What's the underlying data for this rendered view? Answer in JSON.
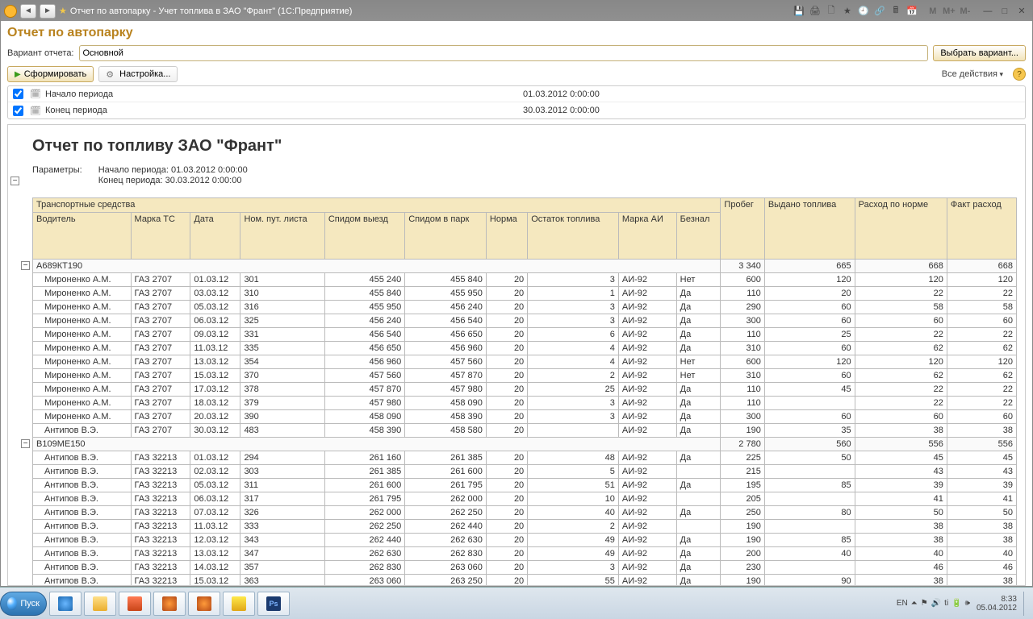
{
  "titlebar": {
    "title": "Отчет по автопарку - Учет топлива в ЗАО \"Франт\"  (1С:Предприятие)",
    "mem_buttons": [
      "M",
      "M+",
      "M-"
    ]
  },
  "form": {
    "title": "Отчет по автопарку",
    "variant_label": "Вариант отчета:",
    "variant_value": "Основной",
    "choose_variant_btn": "Выбрать вариант...",
    "run_btn": "Сформировать",
    "settings_btn": "Настройка...",
    "all_actions": "Все действия"
  },
  "period": {
    "start_label": "Начало периода",
    "start_value": "01.03.2012 0:00:00",
    "end_label": "Конец периода",
    "end_value": "30.03.2012 0:00:00"
  },
  "report": {
    "title": "Отчет по топливу ЗАО \"Франт\"",
    "params_label": "Параметры:",
    "params_lines": [
      "Начало периода: 01.03.2012 0:00:00",
      "Конец периода: 30.03.2012 0:00:00"
    ],
    "group_header": "Транспортные средства",
    "columns_top": {
      "mileage": "Пробег",
      "fuel_issued": "Выдано топлива",
      "norm_consumption": "Расход по норме",
      "actual_consumption": "Факт расход"
    },
    "columns": [
      "Водитель",
      "Марка ТС",
      "Дата",
      "Ном. пут. листа",
      "Спидом выезд",
      "Спидом в парк",
      "Норма",
      "Остаток топлива",
      "Марка АИ",
      "Безнал"
    ],
    "groups": [
      {
        "name": "А689КТ190",
        "totals": {
          "mileage": "3 340",
          "issued": "665",
          "norm": "668",
          "actual": "668"
        },
        "rows": [
          {
            "driver": "Мироненко А.М.",
            "make": "ГАЗ 2707",
            "date": "01.03.12",
            "waybill": "301",
            "odo_out": "455 240",
            "odo_in": "455 840",
            "norm": "20",
            "rest": "3",
            "fuel": "АИ-92",
            "cashless": "Нет",
            "mileage": "600",
            "issued": "120",
            "normc": "120",
            "actual": "120"
          },
          {
            "driver": "Мироненко А.М.",
            "make": "ГАЗ 2707",
            "date": "03.03.12",
            "waybill": "310",
            "odo_out": "455 840",
            "odo_in": "455 950",
            "norm": "20",
            "rest": "1",
            "fuel": "АИ-92",
            "cashless": "Да",
            "mileage": "110",
            "issued": "20",
            "normc": "22",
            "actual": "22"
          },
          {
            "driver": "Мироненко А.М.",
            "make": "ГАЗ 2707",
            "date": "05.03.12",
            "waybill": "316",
            "odo_out": "455 950",
            "odo_in": "456 240",
            "norm": "20",
            "rest": "3",
            "fuel": "АИ-92",
            "cashless": "Да",
            "mileage": "290",
            "issued": "60",
            "normc": "58",
            "actual": "58"
          },
          {
            "driver": "Мироненко А.М.",
            "make": "ГАЗ 2707",
            "date": "06.03.12",
            "waybill": "325",
            "odo_out": "456 240",
            "odo_in": "456 540",
            "norm": "20",
            "rest": "3",
            "fuel": "АИ-92",
            "cashless": "Да",
            "mileage": "300",
            "issued": "60",
            "normc": "60",
            "actual": "60"
          },
          {
            "driver": "Мироненко А.М.",
            "make": "ГАЗ 2707",
            "date": "09.03.12",
            "waybill": "331",
            "odo_out": "456 540",
            "odo_in": "456 650",
            "norm": "20",
            "rest": "6",
            "fuel": "АИ-92",
            "cashless": "Да",
            "mileage": "110",
            "issued": "25",
            "normc": "22",
            "actual": "22"
          },
          {
            "driver": "Мироненко А.М.",
            "make": "ГАЗ 2707",
            "date": "11.03.12",
            "waybill": "335",
            "odo_out": "456 650",
            "odo_in": "456 960",
            "norm": "20",
            "rest": "4",
            "fuel": "АИ-92",
            "cashless": "Да",
            "mileage": "310",
            "issued": "60",
            "normc": "62",
            "actual": "62"
          },
          {
            "driver": "Мироненко А.М.",
            "make": "ГАЗ 2707",
            "date": "13.03.12",
            "waybill": "354",
            "odo_out": "456 960",
            "odo_in": "457 560",
            "norm": "20",
            "rest": "4",
            "fuel": "АИ-92",
            "cashless": "Нет",
            "mileage": "600",
            "issued": "120",
            "normc": "120",
            "actual": "120"
          },
          {
            "driver": "Мироненко А.М.",
            "make": "ГАЗ 2707",
            "date": "15.03.12",
            "waybill": "370",
            "odo_out": "457 560",
            "odo_in": "457 870",
            "norm": "20",
            "rest": "2",
            "fuel": "АИ-92",
            "cashless": "Нет",
            "mileage": "310",
            "issued": "60",
            "normc": "62",
            "actual": "62"
          },
          {
            "driver": "Мироненко А.М.",
            "make": "ГАЗ 2707",
            "date": "17.03.12",
            "waybill": "378",
            "odo_out": "457 870",
            "odo_in": "457 980",
            "norm": "20",
            "rest": "25",
            "fuel": "АИ-92",
            "cashless": "Да",
            "mileage": "110",
            "issued": "45",
            "normc": "22",
            "actual": "22"
          },
          {
            "driver": "Мироненко А.М.",
            "make": "ГАЗ 2707",
            "date": "18.03.12",
            "waybill": "379",
            "odo_out": "457 980",
            "odo_in": "458 090",
            "norm": "20",
            "rest": "3",
            "fuel": "АИ-92",
            "cashless": "Да",
            "mileage": "110",
            "issued": "",
            "normc": "22",
            "actual": "22"
          },
          {
            "driver": "Мироненко А.М.",
            "make": "ГАЗ 2707",
            "date": "20.03.12",
            "waybill": "390",
            "odo_out": "458 090",
            "odo_in": "458 390",
            "norm": "20",
            "rest": "3",
            "fuel": "АИ-92",
            "cashless": "Да",
            "mileage": "300",
            "issued": "60",
            "normc": "60",
            "actual": "60"
          },
          {
            "driver": "Антипов В.Э.",
            "make": "ГАЗ 2707",
            "date": "30.03.12",
            "waybill": "483",
            "odo_out": "458 390",
            "odo_in": "458 580",
            "norm": "20",
            "rest": "",
            "fuel": "АИ-92",
            "cashless": "Да",
            "mileage": "190",
            "issued": "35",
            "normc": "38",
            "actual": "38"
          }
        ]
      },
      {
        "name": "В109МЕ150",
        "totals": {
          "mileage": "2 780",
          "issued": "560",
          "norm": "556",
          "actual": "556"
        },
        "rows": [
          {
            "driver": "Антипов В.Э.",
            "make": "ГАЗ 32213",
            "date": "01.03.12",
            "waybill": "294",
            "odo_out": "261 160",
            "odo_in": "261 385",
            "norm": "20",
            "rest": "48",
            "fuel": "АИ-92",
            "cashless": "Да",
            "mileage": "225",
            "issued": "50",
            "normc": "45",
            "actual": "45"
          },
          {
            "driver": "Антипов В.Э.",
            "make": "ГАЗ 32213",
            "date": "02.03.12",
            "waybill": "303",
            "odo_out": "261 385",
            "odo_in": "261 600",
            "norm": "20",
            "rest": "5",
            "fuel": "АИ-92",
            "cashless": "",
            "mileage": "215",
            "issued": "",
            "normc": "43",
            "actual": "43"
          },
          {
            "driver": "Антипов В.Э.",
            "make": "ГАЗ 32213",
            "date": "05.03.12",
            "waybill": "311",
            "odo_out": "261 600",
            "odo_in": "261 795",
            "norm": "20",
            "rest": "51",
            "fuel": "АИ-92",
            "cashless": "Да",
            "mileage": "195",
            "issued": "85",
            "normc": "39",
            "actual": "39"
          },
          {
            "driver": "Антипов В.Э.",
            "make": "ГАЗ 32213",
            "date": "06.03.12",
            "waybill": "317",
            "odo_out": "261 795",
            "odo_in": "262 000",
            "norm": "20",
            "rest": "10",
            "fuel": "АИ-92",
            "cashless": "",
            "mileage": "205",
            "issued": "",
            "normc": "41",
            "actual": "41"
          },
          {
            "driver": "Антипов В.Э.",
            "make": "ГАЗ 32213",
            "date": "07.03.12",
            "waybill": "326",
            "odo_out": "262 000",
            "odo_in": "262 250",
            "norm": "20",
            "rest": "40",
            "fuel": "АИ-92",
            "cashless": "Да",
            "mileage": "250",
            "issued": "80",
            "normc": "50",
            "actual": "50"
          },
          {
            "driver": "Антипов В.Э.",
            "make": "ГАЗ 32213",
            "date": "11.03.12",
            "waybill": "333",
            "odo_out": "262 250",
            "odo_in": "262 440",
            "norm": "20",
            "rest": "2",
            "fuel": "АИ-92",
            "cashless": "",
            "mileage": "190",
            "issued": "",
            "normc": "38",
            "actual": "38"
          },
          {
            "driver": "Антипов В.Э.",
            "make": "ГАЗ 32213",
            "date": "12.03.12",
            "waybill": "343",
            "odo_out": "262 440",
            "odo_in": "262 630",
            "norm": "20",
            "rest": "49",
            "fuel": "АИ-92",
            "cashless": "Да",
            "mileage": "190",
            "issued": "85",
            "normc": "38",
            "actual": "38"
          },
          {
            "driver": "Антипов В.Э.",
            "make": "ГАЗ 32213",
            "date": "13.03.12",
            "waybill": "347",
            "odo_out": "262 630",
            "odo_in": "262 830",
            "norm": "20",
            "rest": "49",
            "fuel": "АИ-92",
            "cashless": "Да",
            "mileage": "200",
            "issued": "40",
            "normc": "40",
            "actual": "40"
          },
          {
            "driver": "Антипов В.Э.",
            "make": "ГАЗ 32213",
            "date": "14.03.12",
            "waybill": "357",
            "odo_out": "262 830",
            "odo_in": "263 060",
            "norm": "20",
            "rest": "3",
            "fuel": "АИ-92",
            "cashless": "Да",
            "mileage": "230",
            "issued": "",
            "normc": "46",
            "actual": "46"
          },
          {
            "driver": "Антипов В.Э.",
            "make": "ГАЗ 32213",
            "date": "15.03.12",
            "waybill": "363",
            "odo_out": "263 060",
            "odo_in": "263 250",
            "norm": "20",
            "rest": "55",
            "fuel": "АИ-92",
            "cashless": "Да",
            "mileage": "190",
            "issued": "90",
            "normc": "38",
            "actual": "38"
          }
        ]
      }
    ]
  },
  "taskbar": {
    "start": "Пуск",
    "lang": "EN",
    "time": "8:33",
    "date": "05.04.2012"
  }
}
